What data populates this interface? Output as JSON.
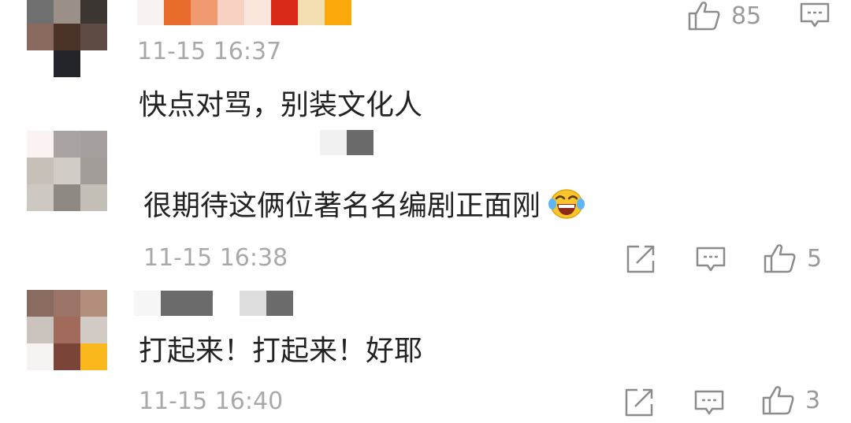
{
  "comments": [
    {
      "time": "11-15 16:37",
      "text": "快点对骂，别装文化人",
      "likes": "85"
    },
    {
      "time": "11-15 16:38",
      "text": "很期待这俩位著名名编剧正面刚",
      "emoji": "laughing-tears-emoji",
      "likes": "5"
    },
    {
      "time": "11-15 16:40",
      "text": "打起来！打起来！好耶",
      "likes": "3"
    }
  ],
  "icons": {
    "like": "thumbs-up-icon",
    "reply": "comment-icon",
    "share": "share-icon"
  },
  "colors": {
    "text": "#222222",
    "meta": "#a9a9a9",
    "icon": "#8c8c8c"
  }
}
